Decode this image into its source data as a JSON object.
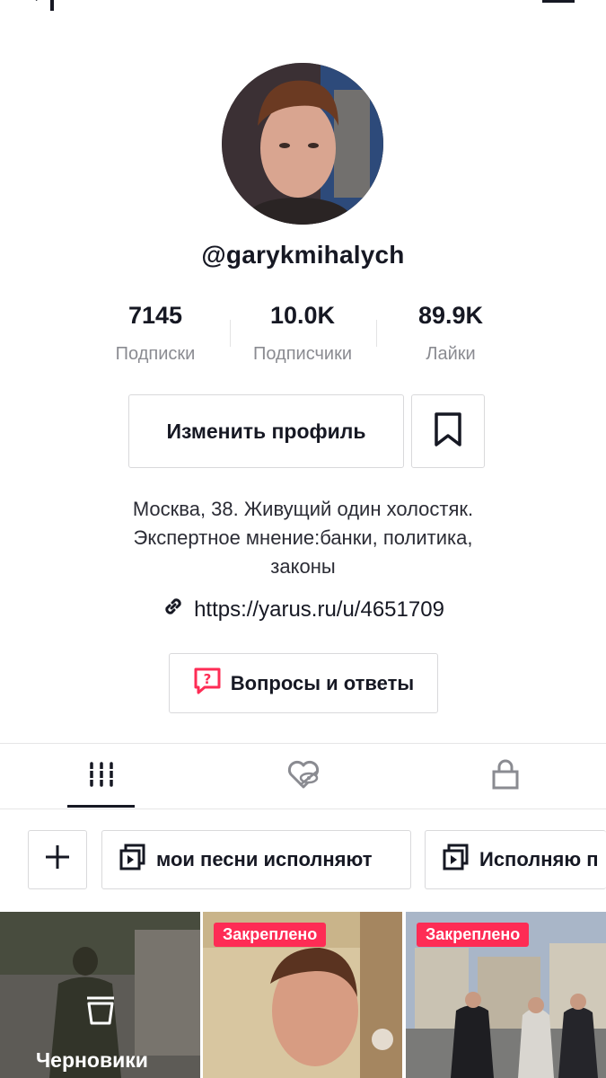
{
  "profile": {
    "username": "@garykmihalych",
    "stats": [
      {
        "value": "7145",
        "label": "Подписки"
      },
      {
        "value": "10.0K",
        "label": "Подписчики"
      },
      {
        "value": "89.9K",
        "label": "Лайки"
      }
    ],
    "edit_button": "Изменить профиль",
    "bio_lines": [
      "Москва, 38. Живущий один холостяк.",
      "Экспертное мнение:банки, политика,",
      "законы"
    ],
    "link": "https://yarus.ru/u/4651709",
    "qa_button": "Вопросы и ответы"
  },
  "tabs": [
    {
      "icon": "grid-icon",
      "active": true
    },
    {
      "icon": "liked-hidden-heart-icon",
      "active": false
    },
    {
      "icon": "lock-icon",
      "active": false
    }
  ],
  "playlists": [
    {
      "label": "мои песни исполняют",
      "icon": "playlist-icon"
    },
    {
      "label": "Исполняю п",
      "icon": "playlist-icon"
    }
  ],
  "videos": [
    {
      "label": "Черновики",
      "icon": "trash-icon"
    },
    {
      "badge": "Закреплено"
    },
    {
      "badge": "Закреплено"
    }
  ],
  "colors": {
    "accent": "#fe2c55",
    "text": "#161823",
    "muted": "#8a8b91",
    "border": "#d9d9db"
  }
}
